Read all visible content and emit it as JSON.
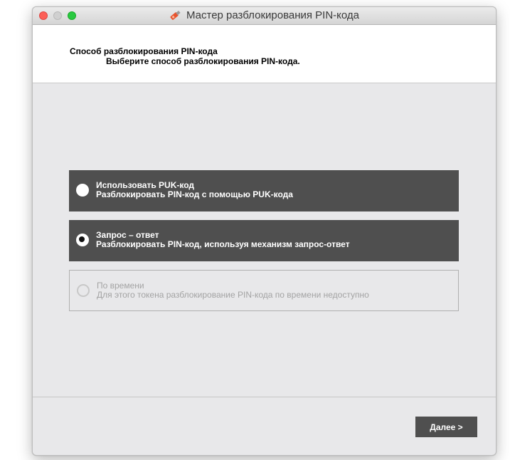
{
  "window": {
    "title": "Мастер разблокирования PIN-кода",
    "title_icon": "key-token-icon"
  },
  "header": {
    "title": "Способ разблокирования PIN-кода",
    "subtitle": "Выберите способ разблокирования PIN-кода."
  },
  "options": [
    {
      "title": "Использовать PUK-код",
      "description": "Разблокировать PIN-код с помощью PUK-кода",
      "selected": false,
      "enabled": true
    },
    {
      "title": "Запрос – ответ",
      "description": "Разблокировать PIN-код, используя механизм запрос-ответ",
      "selected": true,
      "enabled": true
    },
    {
      "title": "По времени",
      "description": "Для этого токена разблокирование PIN-кода по времени недоступно",
      "selected": false,
      "enabled": false
    }
  ],
  "footer": {
    "next_label": "Далее >"
  },
  "colors": {
    "option_bg": "#4f4f4f",
    "window_bg": "#e8e8ea",
    "close": "#fc5f57",
    "maximize": "#29c940"
  }
}
